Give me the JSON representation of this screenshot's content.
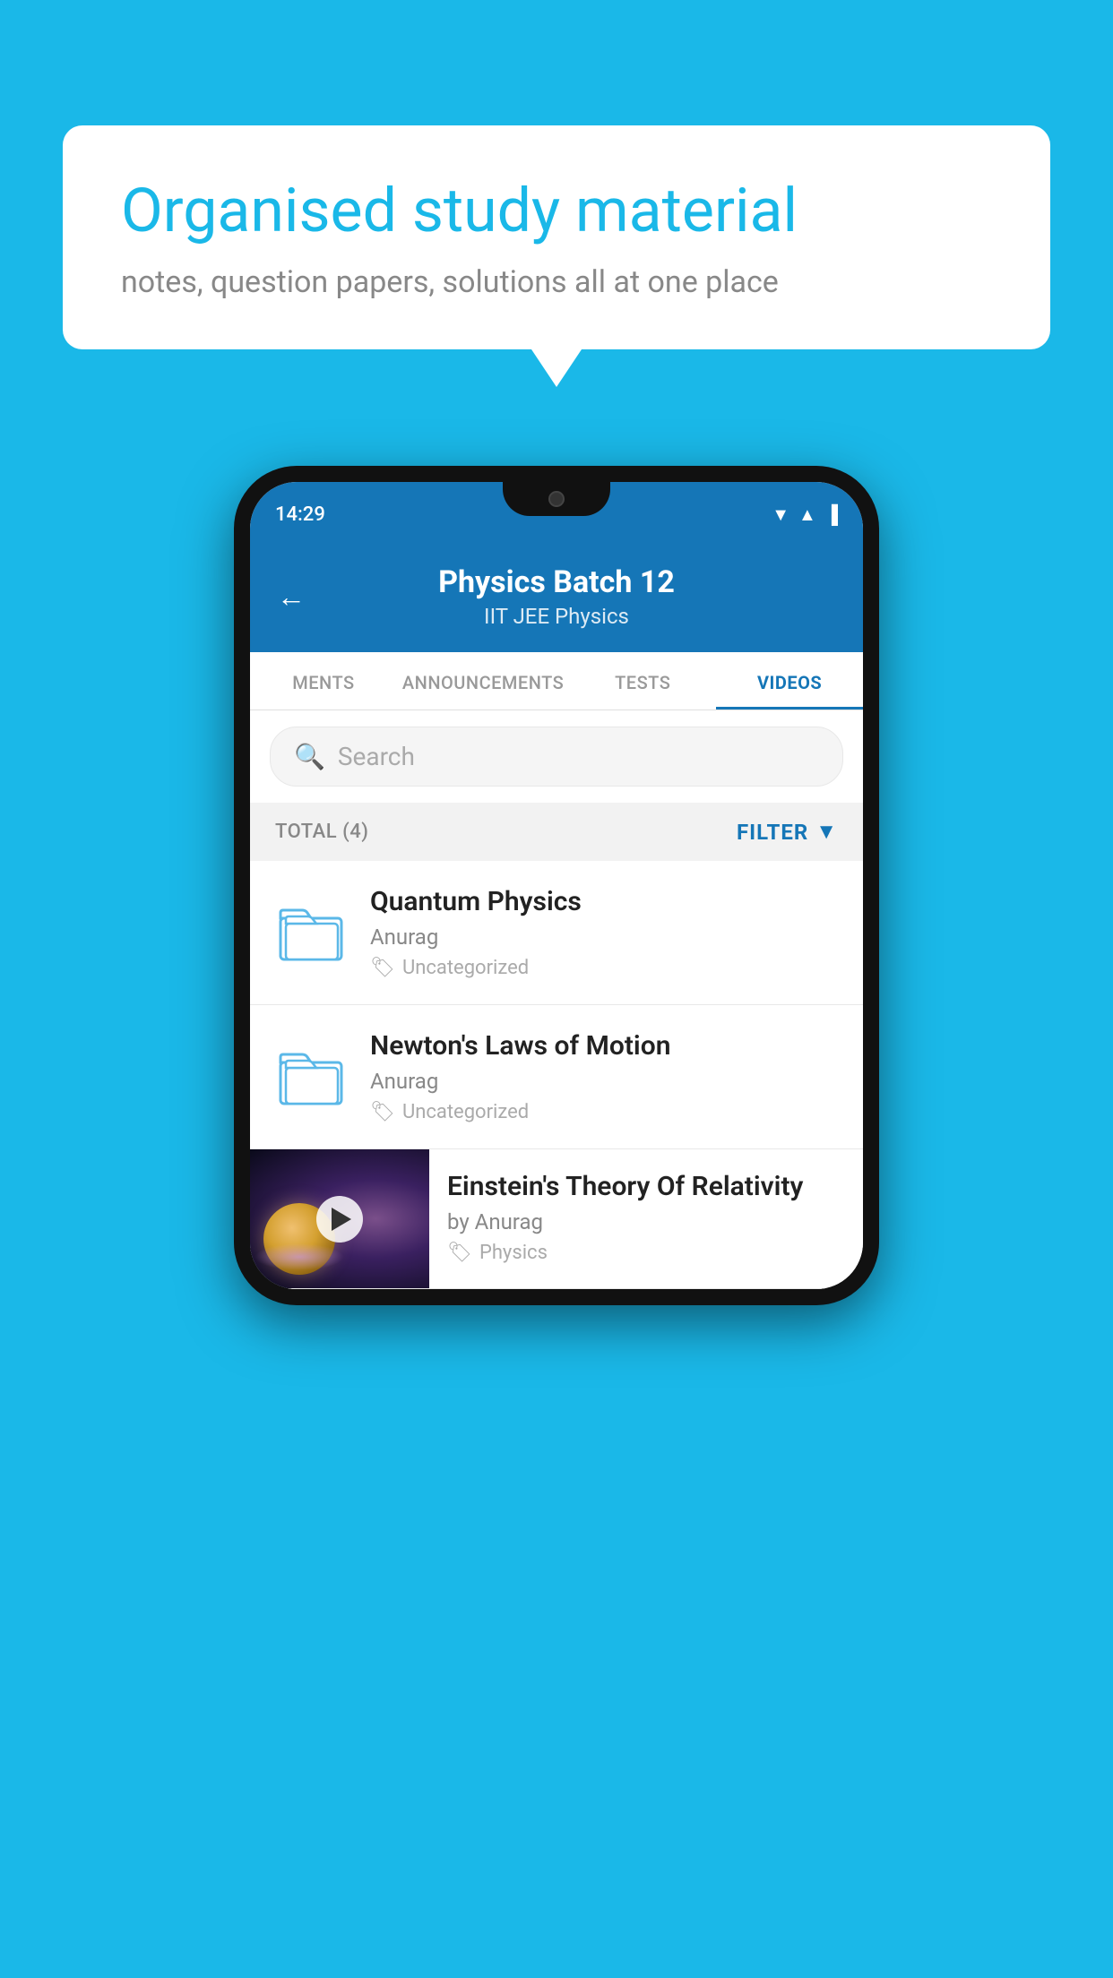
{
  "background_color": "#1ab8e8",
  "speech_bubble": {
    "title": "Organised study material",
    "subtitle": "notes, question papers, solutions all at one place"
  },
  "phone": {
    "status_bar": {
      "time": "14:29"
    },
    "header": {
      "title": "Physics Batch 12",
      "subtitle": "IIT JEE   Physics",
      "back_label": "←"
    },
    "tabs": [
      {
        "label": "MENTS",
        "active": false
      },
      {
        "label": "ANNOUNCEMENTS",
        "active": false
      },
      {
        "label": "TESTS",
        "active": false
      },
      {
        "label": "VIDEOS",
        "active": true
      }
    ],
    "search": {
      "placeholder": "Search"
    },
    "filter": {
      "total_label": "TOTAL (4)",
      "filter_label": "FILTER"
    },
    "videos": [
      {
        "title": "Quantum Physics",
        "author": "Anurag",
        "tag": "Uncategorized",
        "type": "folder"
      },
      {
        "title": "Newton's Laws of Motion",
        "author": "Anurag",
        "tag": "Uncategorized",
        "type": "folder"
      },
      {
        "title": "Einstein's Theory Of Relativity",
        "author": "by Anurag",
        "tag": "Physics",
        "type": "video"
      }
    ]
  }
}
